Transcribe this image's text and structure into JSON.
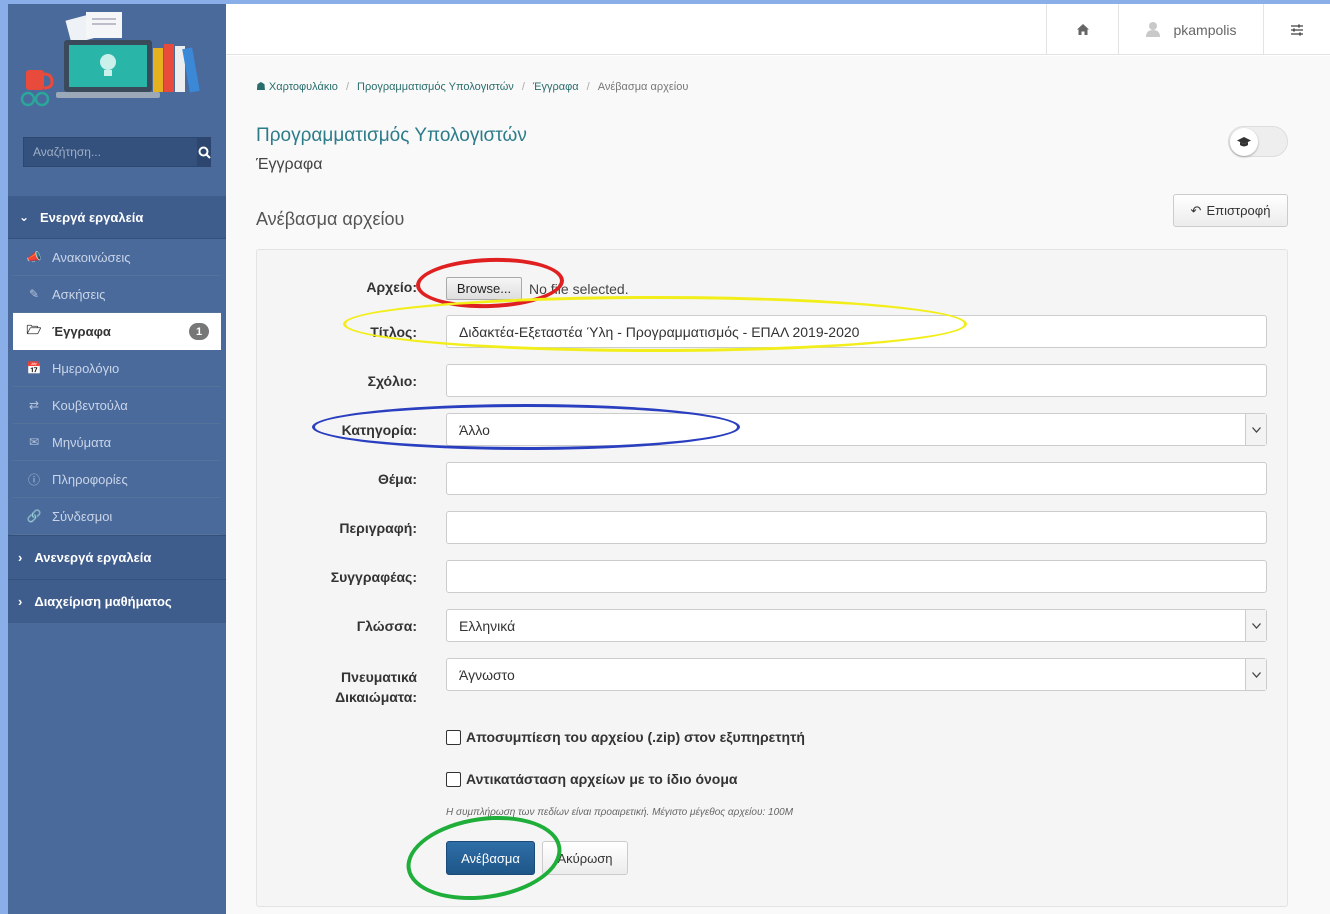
{
  "sidebar": {
    "search": {
      "placeholder": "Αναζήτηση..."
    },
    "active_tools_header": "Ενεργά εργαλεία",
    "items": [
      {
        "label": "Ανακοινώσεις",
        "icon": "megaphone-icon"
      },
      {
        "label": "Ασκήσεις",
        "icon": "edit-icon"
      },
      {
        "label": "Έγγραφα",
        "icon": "folder-open-icon",
        "badge": "1",
        "active": true
      },
      {
        "label": "Ημερολόγιο",
        "icon": "calendar-icon"
      },
      {
        "label": "Κουβεντούλα",
        "icon": "exchange-icon"
      },
      {
        "label": "Μηνύματα",
        "icon": "envelope-icon"
      },
      {
        "label": "Πληροφορίες",
        "icon": "info-icon"
      },
      {
        "label": "Σύνδεσμοι",
        "icon": "link-icon"
      }
    ],
    "inactive_tools_header": "Ανενεργά εργαλεία",
    "course_admin_header": "Διαχείριση μαθήματος"
  },
  "topbar": {
    "username": "pkampolis"
  },
  "breadcrumb": [
    "Χαρτοφυλάκιο",
    "Προγραμματισμός Υπολογιστών",
    "Έγγραφα",
    "Ανέβασμα αρχείου"
  ],
  "course_title": "Προγραμματισμός Υπολογιστών",
  "section_title": "Έγγραφα",
  "page_heading": "Ανέβασμα αρχείου",
  "back_button": "Επιστροφή",
  "form": {
    "file_label": "Αρχείο:",
    "browse_label": "Browse...",
    "file_status": "No file selected.",
    "title_label": "Τίτλος:",
    "title_value": "Διδακτέα-Εξεταστέα Ύλη - Προγραμματισμός - ΕΠΑΛ 2019-2020",
    "comment_label": "Σχόλιο:",
    "comment_value": "",
    "category_label": "Κατηγορία:",
    "category_value": "Άλλο",
    "subject_label": "Θέμα:",
    "description_label": "Περιγραφή:",
    "author_label": "Συγγραφέας:",
    "language_label": "Γλώσσα:",
    "language_value": "Ελληνικά",
    "copyright_label_1": "Πνευματικά",
    "copyright_label_2": "Δικαιώματα:",
    "copyright_value": "Άγνωστο",
    "unzip_label": "Αποσυμπίεση του αρχείου (.zip) στον εξυπηρετητή",
    "replace_label": "Αντικατάσταση αρχείων με το ίδιο όνομα",
    "hint": "Η συμπλήρωση των πεδίων είναι προαιρετική. Μέγιστο μέγεθος αρχείου: 100M",
    "upload_button": "Ανέβασμα",
    "cancel_button": "Ακύρωση"
  },
  "colors": {
    "annotation_red": "#e02020",
    "annotation_yellow": "#f2ee1a",
    "annotation_blue": "#2a3fbf",
    "annotation_green": "#1fae3a",
    "sidebar_bg": "#4a6a9c",
    "primary_button": "#2f6ea7"
  }
}
